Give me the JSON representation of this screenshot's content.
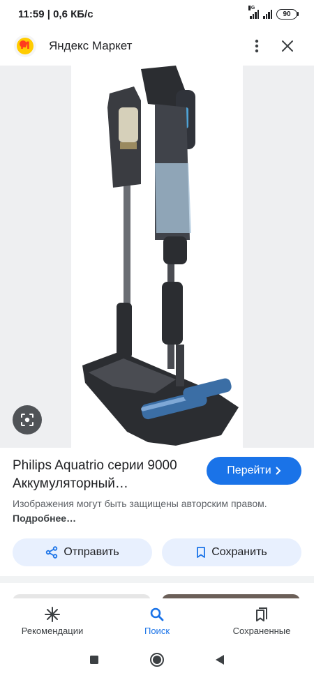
{
  "status_bar": {
    "time_speed": "11:59 | 0,6 КБ/с",
    "network": "4G",
    "battery": "90"
  },
  "header": {
    "source_name": "Яндекс Маркет",
    "logo_letter": "М",
    "icons": [
      "more-vert-icon",
      "close-icon"
    ]
  },
  "image": {
    "subject": "vacuum-cleaner-product-photo"
  },
  "result": {
    "title": "Philips Aquatrio серии 9000 Аккумуляторный…",
    "visit_label": "Перейти",
    "copyright_text": "Изображения могут быть защищены авторским правом.",
    "more_link": "Подробнее…"
  },
  "actions": {
    "share_label": "Отправить",
    "save_label": "Сохранить"
  },
  "bottom_nav": {
    "items": [
      {
        "label": "Рекомендации",
        "icon": "asterisk-icon",
        "active": false
      },
      {
        "label": "Поиск",
        "icon": "search-icon",
        "active": true
      },
      {
        "label": "Сохраненные",
        "icon": "collections-icon",
        "active": false
      }
    ]
  },
  "colors": {
    "accent": "#1a73e8",
    "tonal_button": "#e8f0fe",
    "image_bg": "#eeeff1"
  }
}
